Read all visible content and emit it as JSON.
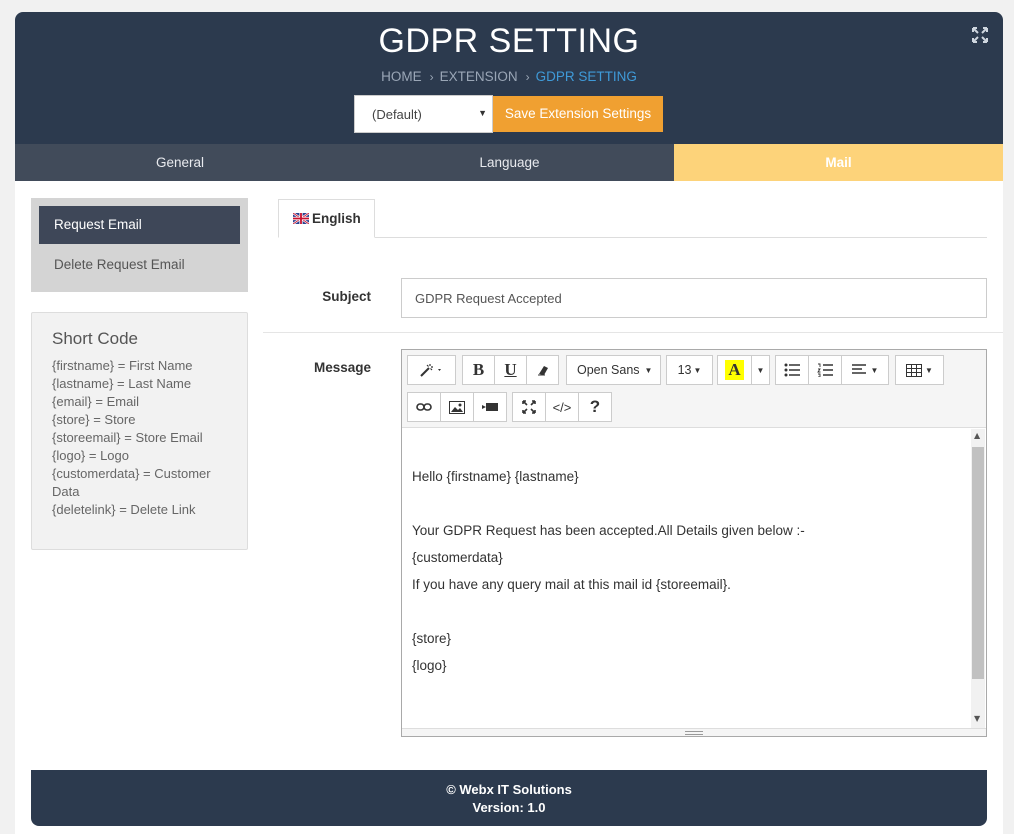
{
  "header": {
    "title": "GDPR SETTING",
    "breadcrumb": [
      "HOME",
      "EXTENSION",
      "GDPR SETTING"
    ],
    "separator": "›",
    "store_select": "(Default)",
    "save_label": "Save Extension Settings"
  },
  "tabs": [
    "General",
    "Language",
    "Mail"
  ],
  "active_tab": "Mail",
  "side_nav": [
    "Request Email",
    "Delete Request Email"
  ],
  "shortcode": {
    "title": "Short Code",
    "lines": [
      "{firstname} = First Name",
      "{lastname} = Last Name",
      "{email} = Email",
      "{store} = Store",
      "{storeemail} = Store Email",
      "{logo} = Logo",
      "{customerdata} = Customer Data",
      "{deletelink} = Delete Link"
    ]
  },
  "language_tab": "English",
  "form": {
    "subject_label": "Subject",
    "subject_value": "GDPR Request Accepted",
    "message_label": "Message"
  },
  "toolbar": {
    "font_name": "Open Sans",
    "font_size": "13",
    "color_letter": "A",
    "code_label": "</>",
    "help_label": "?"
  },
  "message_lines": [
    "",
    "Hello {firstname} {lastname}",
    "",
    "Your GDPR Request has been accepted.All Details given below :-",
    "{customerdata}",
    "If you have any query mail at this mail id {storeemail}.",
    "",
    "{store}",
    "{logo}"
  ],
  "footer": {
    "copyright": "© Webx IT Solutions",
    "version": "Version: 1.0"
  },
  "colors": {
    "header_bg": "#2c3a4e",
    "accent": "#f0a031",
    "active_tab": "#fdd37a",
    "breadcrumb_active": "#3f9ad8"
  }
}
